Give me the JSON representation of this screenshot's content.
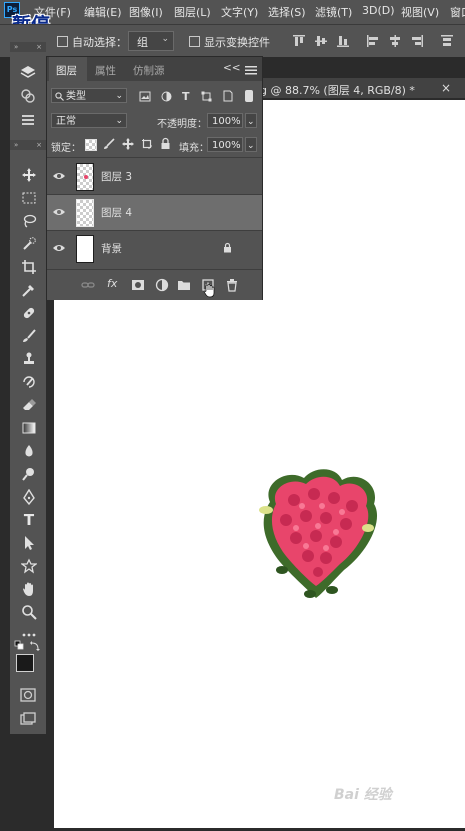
{
  "app": {
    "logo": "Ps",
    "overlay_status": "暂停"
  },
  "menu": [
    {
      "label": "文件(F)"
    },
    {
      "label": "编辑(E)"
    },
    {
      "label": "图像(I)"
    },
    {
      "label": "图层(L)"
    },
    {
      "label": "文字(Y)"
    },
    {
      "label": "选择(S)"
    },
    {
      "label": "滤镜(T)"
    },
    {
      "label": "3D(D)"
    },
    {
      "label": "视图(V)"
    },
    {
      "label": "窗口"
    }
  ],
  "options_bar": {
    "auto_select_label": "自动选择：",
    "auto_select_checked": false,
    "auto_select_value": "组",
    "show_transform_label": "显示变换控件",
    "show_transform_checked": false
  },
  "document_tab": {
    "label": "g @ 88.7% (图层 4, RGB/8) *",
    "close": "×"
  },
  "layers_panel": {
    "tabs": [
      "图层",
      "属性",
      "仿制源"
    ],
    "active_tab": "图层",
    "collapse_glyph": "<<",
    "filter_type": "类型",
    "blend_mode": "正常",
    "opacity_label": "不透明度：",
    "opacity_value": "100%",
    "lock_label": "锁定：",
    "fill_label": "填充：",
    "fill_value": "100%",
    "layers": [
      {
        "name": "图层 3",
        "visible": true,
        "selected": false,
        "thumb": "transparent-with-red-dot"
      },
      {
        "name": "图层 4",
        "visible": true,
        "selected": true,
        "thumb": "transparent"
      },
      {
        "name": "背景",
        "visible": true,
        "selected": false,
        "thumb": "white",
        "locked": true
      }
    ],
    "footer_icons": [
      "link-icon",
      "fx-icon",
      "mask-icon",
      "adjustment-icon",
      "folder-icon",
      "new-layer-icon",
      "trash-icon"
    ],
    "fx_label": "fx"
  },
  "tools": [
    "move-icon",
    "marquee-icon",
    "lasso-icon",
    "quick-select-icon",
    "crop-icon",
    "eyedropper-icon",
    "healing-icon",
    "brush-icon",
    "stamp-icon",
    "history-brush-icon",
    "eraser-icon",
    "gradient-icon",
    "blur-icon",
    "dodge-icon",
    "pen-icon",
    "type-icon",
    "path-select-icon",
    "shape-icon",
    "hand-icon",
    "zoom-icon",
    "more-icon"
  ],
  "tool_type_glyph": "T",
  "colors": {
    "foreground": "#1a1a1a",
    "background": "#ffffff",
    "accent": "#31a8ff",
    "rose": "#e8456b"
  },
  "watermark": "Bai 经验"
}
